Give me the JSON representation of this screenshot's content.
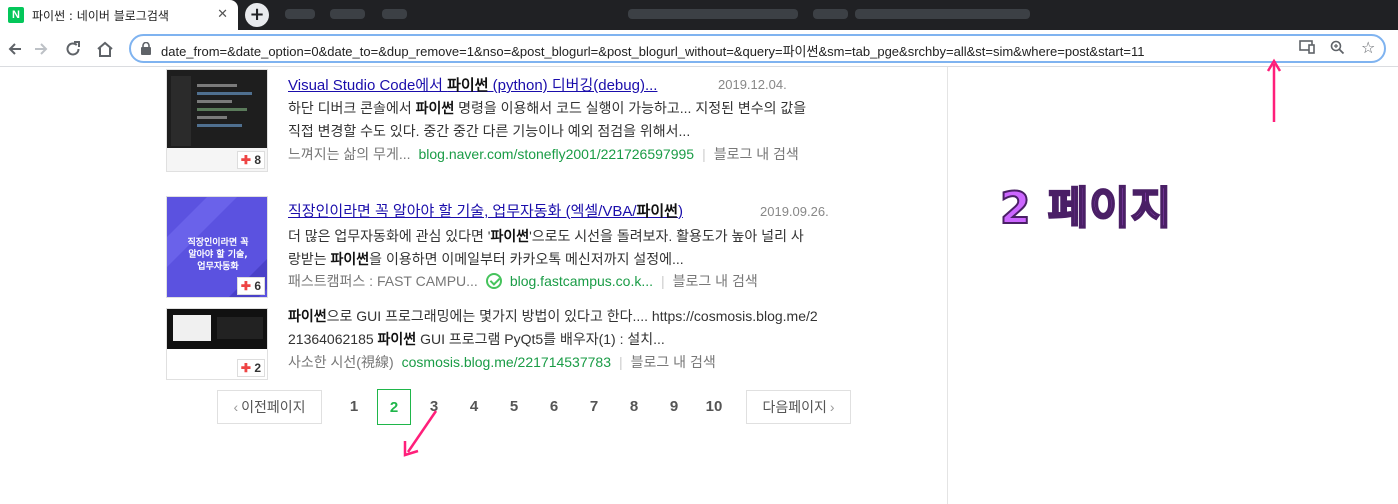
{
  "browser": {
    "tab": {
      "title": "파이썬 : 네이버 블로그검색",
      "favicon_letter": "N"
    },
    "url": "date_from=&date_option=0&date_to=&dup_remove=1&nso=&post_blogurl=&post_blogurl_without=&query=파이썬&sm=tab_pge&srchby=all&st=sim&where=post&start=11"
  },
  "results": [
    {
      "title_pre": "Visual Studio Code에서 ",
      "title_bold": "파이썬",
      "title_post": " (python) 디버깅(debug)...",
      "date": "2019.12.04.",
      "desc_line1_bold": "",
      "desc_line1": "하단 디버크 콘솔에서 ",
      "desc_line1_b": "파이썬",
      "desc_line1_rest": " 명령을 이용해서 코드 실행이 가능하고... 지정된 변수의 값을",
      "desc_line2": "직접 변경할 수도 있다. 중간 중간 다른 기능이나 예외 점검을 위해서...",
      "author": "느껴지는 삶의 무게...",
      "site": "blog.naver.com/stonefly2001/221726597995",
      "in_blog": "블로그 내 검색",
      "thumb_count": "8"
    },
    {
      "title_pre": "직장인이라면 꼭 알아야 할 기술, 업무자동화 (엑셀/VBA/",
      "title_bold": "파이썬",
      "title_post": ")",
      "date": "2019.09.26.",
      "desc_line1": "더 많은 업무자동화에 관심 있다면 '",
      "desc_line1_b": "파이썬",
      "desc_line1_rest": "'으로도 시선을 돌려보자. 활용도가 높아 널리 사",
      "desc_line2_pre": "랑받는 ",
      "desc_line2_b": "파이썬",
      "desc_line2_rest": "을 이용하면 이메일부터 카카오톡 메신저까지 설정에...",
      "author": "패스트캠퍼스 : FAST CAMPU...",
      "site": "blog.fastcampus.co.k...",
      "in_blog": "블로그 내 검색",
      "thumb_count": "6",
      "thumb_text": "직장인이라면 꼭 알아야 할 기술, 업무자동화"
    },
    {
      "desc_line1_b": "파이썬",
      "desc_line1_rest": "으로 GUI 프로그래밍에는 몇가지 방법이 있다고 한다.... https://cosmosis.blog.me/2",
      "desc_line2_pre": "21364062185 ",
      "desc_line2_b": "파이썬",
      "desc_line2_rest": " GUI 프로그램 PyQt5를 배우자(1) : 설치...",
      "author": "사소한 시선(視線)",
      "site": "cosmosis.blog.me/221714537783",
      "in_blog": "블로그 내 검색",
      "thumb_count": "2"
    }
  ],
  "pagination": {
    "prev": "이전페이지",
    "next": "다음페이지",
    "pages": [
      "1",
      "2",
      "3",
      "4",
      "5",
      "6",
      "7",
      "8",
      "9",
      "10"
    ],
    "current": "2"
  },
  "annotation": "2 페이지",
  "colors": {
    "arrow": "#ff1f7a",
    "current_page": "#1fb64a",
    "link": "#1a0dab",
    "site": "#1a9c46"
  }
}
